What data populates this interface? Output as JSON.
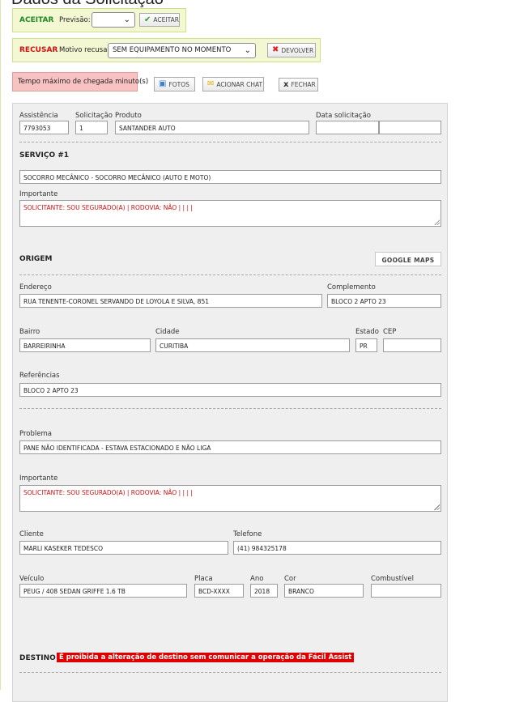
{
  "page": {
    "title": "Dados da Solicitação"
  },
  "accept_bar": {
    "label": "ACEITAR",
    "forecast_label": "Previsão:",
    "forecast_value": "",
    "button_label": "ACEITAR",
    "button_icon": "check-icon"
  },
  "refuse_bar": {
    "label": "RECUSAR",
    "reason_label": "Motivo recusa:",
    "reason_value": "SEM EQUIPAMENTO NO MOMENTO",
    "button_label": "DEVOLVER",
    "button_icon": "cross-icon"
  },
  "alert": {
    "text": "Tempo máximo de chegada minuto(s)"
  },
  "toolbar": {
    "photos_label": "FOTOS",
    "chat_label": "ACIONAR CHAT",
    "close_label": "FECHAR"
  },
  "request": {
    "assistencia_label": "Assistência",
    "assistencia": "7793053",
    "solicitacao_label": "Solicitação",
    "solicitacao": "1",
    "produto_label": "Produto",
    "produto": "SANTANDER AUTO",
    "data_label": "Data solicitação",
    "data_date": "",
    "data_time": ""
  },
  "service": {
    "title": "SERVIÇO #1",
    "description": "SOCORRO MECÂNICO - SOCORRO MECÂNICO (AUTO E MOTO)",
    "importante_label": "Importante",
    "importante": "SOLICITANTE: SOU SEGURADO(A) | RODOVIA: NÃO |  |  |  |"
  },
  "origin": {
    "title": "ORIGEM",
    "maps_label": "GOOGLE MAPS",
    "endereco_label": "Endereço",
    "endereco": "RUA TENENTE-CORONEL SERVANDO DE LOYOLA E SILVA, 851",
    "complemento_label": "Complemento",
    "complemento": "BLOCO 2 APTO 23",
    "bairro_label": "Bairro",
    "bairro": "BARREIRINHA",
    "cidade_label": "Cidade",
    "cidade": "CURITIBA",
    "estado_label": "Estado",
    "estado": "PR",
    "cep_label": "CEP",
    "cep": "",
    "referencias_label": "Referências",
    "referencias": "BLOCO 2 APTO 23"
  },
  "problem": {
    "label": "Problema",
    "value": "PANE NÃO IDENTIFICADA - ESTAVA ESTACIONADO E NÃO LIGA",
    "importante_label": "Importante",
    "importante": "SOLICITANTE: SOU SEGURADO(A) | RODOVIA: NÃO |  |  |  |"
  },
  "client": {
    "cliente_label": "Cliente",
    "cliente": "MARLI KASEKER TEDESCO",
    "telefone_label": "Telefone",
    "telefone": "(41) 984325178"
  },
  "vehicle": {
    "veiculo_label": "Veículo",
    "veiculo": "PEUG / 408 SEDAN GRIFFE 1.6 TB",
    "placa_label": "Placa",
    "placa": "BCD-XXXX",
    "ano_label": "Ano",
    "ano": "2018",
    "cor_label": "Cor",
    "cor": "BRANCO",
    "combustivel_label": "Combustível",
    "combustivel": ""
  },
  "destination": {
    "title": "DESTINO",
    "warning": "É proibida a alteração de destino sem comunicar a operação da Fácil Assist"
  },
  "colors": {
    "accept": "#1f8a1f",
    "refuse": "#d01010",
    "alert_bg": "#f9c2c2",
    "bar_bg": "#f3f8d2",
    "warning_bg": "#e00000"
  }
}
